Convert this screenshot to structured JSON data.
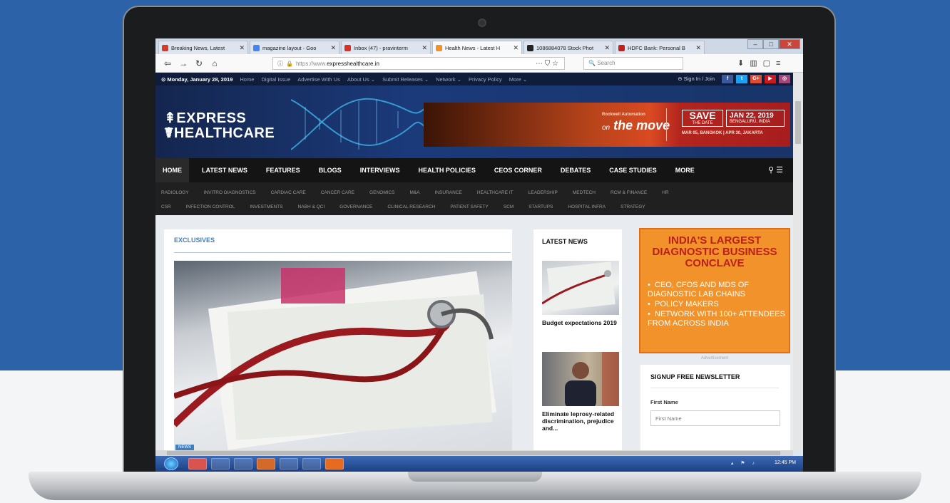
{
  "browser": {
    "tabs": [
      {
        "label": "Breaking News, Latest",
        "color": "#d63a2b",
        "active": false
      },
      {
        "label": "magazine layout - Goo",
        "color": "#4285f4",
        "active": false
      },
      {
        "label": "Inbox (47) - pravinterm",
        "color": "#d93025",
        "active": false
      },
      {
        "label": "Health News - Latest H",
        "color": "#f2922a",
        "active": true
      },
      {
        "label": "1086884078 Stock Phot",
        "color": "#222222",
        "active": false
      },
      {
        "label": "HDFC Bank: Personal B",
        "color": "#c4201a",
        "active": false
      }
    ],
    "url_prefix": "https://www.",
    "url_domain": "expresshealthcare.in",
    "search_placeholder": "Search"
  },
  "site": {
    "date": "Monday, January 28, 2019",
    "top_links": [
      "Home",
      "Digital Issue",
      "Advertise With Us",
      "About Us ⌄",
      "Submit Releases ⌄",
      "Network ⌄",
      "Privacy Policy",
      "More ⌄"
    ],
    "signin": "Sign In / Join",
    "logo_line1": "EXPRESS",
    "logo_line2": "HEALTHCARE",
    "ad": {
      "tag": "Rockwell Automation",
      "on": "on",
      "move": "the move",
      "save": "SAVE",
      "save_sub": "THE DATE",
      "date": "JAN 22, 2019",
      "location": "BENGALURU, INDIA",
      "cities": "MAR 05, BANGKOK | APR 30, JAKARTA"
    },
    "main_nav": [
      "HOME",
      "LATEST NEWS",
      "FEATURES",
      "BLOGS",
      "INTERVIEWS",
      "HEALTH POLICIES",
      "CEOS CORNER",
      "DEBATES",
      "CASE STUDIES",
      "MORE"
    ],
    "sub_nav_row1": [
      "RADIOLOGY",
      "INVITRO DIAGNOSTICS",
      "CARDIAC CARE",
      "CANCER CARE",
      "GENOMICS",
      "M&A",
      "INSURANCE",
      "HEALTHCARE IT",
      "LEADERSHIP",
      "MEDTECH",
      "RCM & FINANCE",
      "HR"
    ],
    "sub_nav_row2": [
      "CSR",
      "INFECTION CONTROL",
      "INVESTMENTS",
      "NABH & QCI",
      "GOVERNANCE",
      "CLINICAL RESEARCH",
      "PATIENT SAFETY",
      "SCM",
      "STARTUPS",
      "HOSPITAL INFRA",
      "STRATEGY"
    ]
  },
  "content": {
    "exclusives_title": "EXCLUSIVES",
    "news_badge": "NEWS",
    "latest_title": "LATEST NEWS",
    "latest_items": [
      "Budget expectations 2019",
      "Eliminate leprosy-related discrimination, prejudice and..."
    ],
    "promo_title": "INDIA'S LARGEST DIAGNOSTIC BUSINESS CONCLAVE",
    "promo_bullets": [
      "CEO, CFOS AND MDS OF DIAGNOSTIC LAB CHAINS",
      "POLICY MAKERS",
      "NETWORK WITH 100+ ATTENDEES FROM ACROSS INDIA"
    ],
    "advertisement": "Advertisement",
    "newsletter_title": "SIGNUP FREE NEWSLETTER",
    "first_name_label": "First Name",
    "first_name_placeholder": "First Name"
  },
  "taskbar": {
    "clock": "12:45 PM"
  },
  "colors": {
    "background_blue": "#2b62a8",
    "site_navy": "#101d3a",
    "promo_orange": "#f2922a",
    "exclusives_blue": "#3d7fc1"
  }
}
